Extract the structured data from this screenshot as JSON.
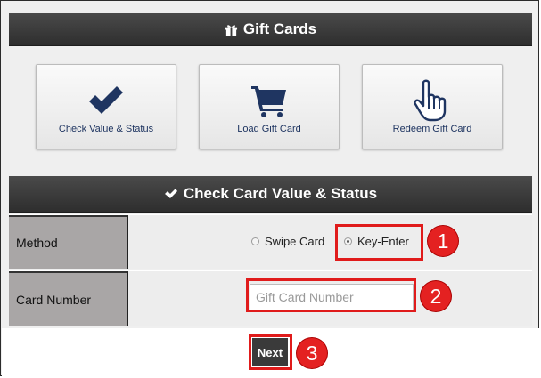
{
  "gift_cards": {
    "title": "Gift Cards",
    "icon": "gift-icon"
  },
  "tiles": [
    {
      "label": "Check Value & Status",
      "icon": "checkmark-icon"
    },
    {
      "label": "Load Gift Card",
      "icon": "shopping-cart-icon"
    },
    {
      "label": "Redeem Gift Card",
      "icon": "hand-pointer-icon"
    }
  ],
  "check_section": {
    "title": "Check Card Value & Status",
    "icon": "checkmark-icon"
  },
  "method": {
    "label": "Method",
    "options": [
      "Swipe Card",
      "Key-Enter"
    ],
    "selected": "Key-Enter"
  },
  "card_number": {
    "label": "Card Number",
    "placeholder": "Gift Card Number",
    "value": ""
  },
  "next_label": "Next",
  "annotations": {
    "step1": "1",
    "step2": "2",
    "step3": "3"
  },
  "colors": {
    "header_bg": "#333333",
    "tile_text": "#1f3561",
    "icon_navy": "#1f3561",
    "callout_red": "#e01b1b",
    "label_bg": "#a9a6a6"
  }
}
